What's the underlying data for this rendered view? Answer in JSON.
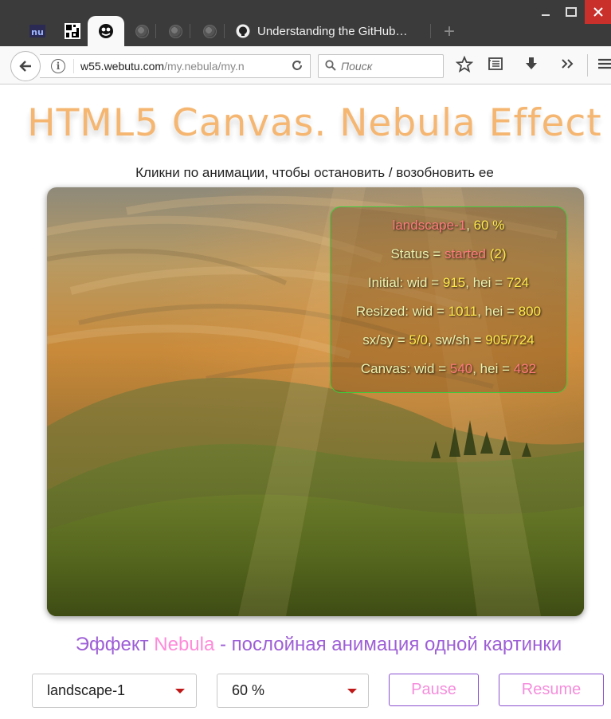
{
  "browser": {
    "tabs": [
      {
        "icon": "nu-logo-icon"
      },
      {
        "icon": "qr-icon"
      },
      {
        "icon": "nebula-face-icon",
        "active": true
      },
      {
        "icon": "globe-icon"
      },
      {
        "icon": "globe-icon"
      },
      {
        "icon": "globe-icon"
      },
      {
        "icon": "github-icon",
        "title": "Understanding the GitHub…"
      }
    ],
    "new_tab_symbol": "+",
    "url_domain": "w55.webutu.com",
    "url_prefix": "",
    "url_path": "/my.nebula/my.n",
    "search_placeholder": "Поиск"
  },
  "page": {
    "title": "HTML5 Canvas. Nebula Effect",
    "hint": "Кликни по анимации, чтобы остановить / возобновить ее",
    "info": {
      "image_name": "landscape-1",
      "percent": "60 %",
      "status_label": "Status = ",
      "status_value": "started",
      "status_count": "(2)",
      "initial_label": "Initial: wid = ",
      "initial_wid": "915",
      "initial_hei_label": ", hei = ",
      "initial_hei": "724",
      "resized_label": "Resized: wid = ",
      "resized_wid": "1011",
      "resized_hei_label": ", hei = ",
      "resized_hei": "800",
      "sxsy_label": "sx/sy = ",
      "sxsy": "5/0",
      "swsh_label": ", sw/sh = ",
      "swsh": "905/724",
      "canvas_label": "Canvas: wid = ",
      "canvas_wid": "540",
      "canvas_hei_label": ", hei = ",
      "canvas_hei": "432"
    },
    "subtitle_pre": "Эффект ",
    "subtitle_highlight": "Nebula",
    "subtitle_post": " - послойная анимация одной картинки",
    "controls": {
      "image_select": "landscape-1",
      "percent_select": "60 %",
      "pause_label": "Pause",
      "resume_label": "Resume"
    }
  },
  "colors": {
    "title": "#f5b36a",
    "subtitle": "#9e5fd6",
    "highlight_pink": "#ff8bd9",
    "button_border": "#8a4fd0",
    "info_border": "#3ecb3e",
    "info_yellow": "#ffe94a",
    "info_red": "#ff7b7b"
  }
}
